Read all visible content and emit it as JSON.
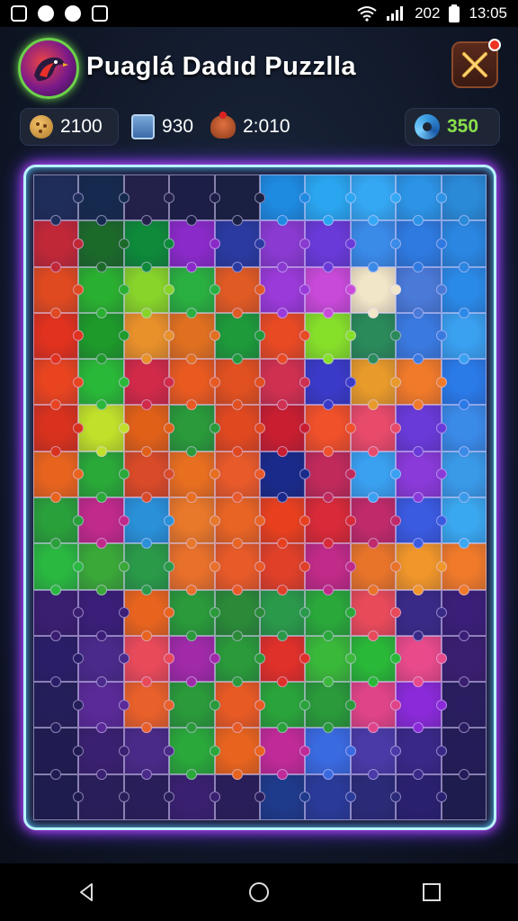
{
  "status_bar": {
    "left_icons": [
      "notification-icon",
      "clock-icon",
      "chat-icon",
      "image-icon"
    ],
    "right_text": "202",
    "time": "13:05"
  },
  "header": {
    "title": "Puaglá Dadıd Puzzlla",
    "avatar_icon": "bird-icon",
    "close_icon": "crossed-tools-icon"
  },
  "stats": {
    "coins": "2100",
    "boxes": "930",
    "time": "2:010",
    "score": "350"
  },
  "board": {
    "cols": 10,
    "rows": 14,
    "colors": [
      "#1f2d5a",
      "#152a4e",
      "#23204a",
      "#1c1e48",
      "#1a2042",
      "#1e8ae0",
      "#2aa6f0",
      "#35a8f4",
      "#2c94e6",
      "#2a8ad8",
      "#c02838",
      "#1c6a2a",
      "#0e8a3a",
      "#8a2ac8",
      "#2a3aa0",
      "#8a3ad0",
      "#6a3ad8",
      "#3a8ae8",
      "#2e7ae0",
      "#2a86e0",
      "#e04a20",
      "#2ab030",
      "#88d42a",
      "#2ab040",
      "#e05a24",
      "#9a3ad8",
      "#c84ad8",
      "#f2e6c8",
      "#4a7ad8",
      "#2a8ae8",
      "#e0321e",
      "#1e9a2a",
      "#e8902a",
      "#e07020",
      "#1e9a3a",
      "#e84a24",
      "#86e02a",
      "#2a8a5a",
      "#3a7ae0",
      "#3aa0f0",
      "#e84420",
      "#2ab838",
      "#d02a48",
      "#e85a20",
      "#e05020",
      "#d03050",
      "#3a3ac8",
      "#e89a2a",
      "#f07a2a",
      "#2a7ae8",
      "#d8321e",
      "#c0e02a",
      "#e06018",
      "#2a9a3a",
      "#e04820",
      "#c81e30",
      "#f0502a",
      "#e84a6a",
      "#6a3ad8",
      "#3a8ae8",
      "#e8641e",
      "#2aa838",
      "#d84a28",
      "#e86e20",
      "#e85a2a",
      "#1a2a8a",
      "#c02a5a",
      "#3aa0f0",
      "#8a3ad8",
      "#3a9ae8",
      "#2aa03a",
      "#c02a8a",
      "#2a90d8",
      "#e8782a",
      "#e86424",
      "#e8401e",
      "#d82a38",
      "#c02a6a",
      "#3a5ae0",
      "#3aa8f0",
      "#2ab840",
      "#3aa838",
      "#2a9a48",
      "#e8702a",
      "#e85a28",
      "#e04028",
      "#c02a88",
      "#e8742a",
      "#f0962a",
      "#f07a2a",
      "#3a1e70",
      "#3a1e78",
      "#e8641e",
      "#2a9a3a",
      "#2a8a38",
      "#2a9a4a",
      "#2aa83a",
      "#e84a5a",
      "#3a2a88",
      "#3a1e78",
      "#2a1e68",
      "#4a2a8a",
      "#e84a5a",
      "#a02aa8",
      "#2a9a3a",
      "#e0302a",
      "#3ab83a",
      "#2ab838",
      "#e84a8a",
      "#3a1e70",
      "#241e5a",
      "#5a2a98",
      "#e8602a",
      "#2a9a3a",
      "#e85a24",
      "#2aa43a",
      "#2a9a3a",
      "#e04488",
      "#8a2ad8",
      "#2a1e60",
      "#201c52",
      "#3a2070",
      "#4a2a88",
      "#2aa83a",
      "#e8641e",
      "#c02a98",
      "#3a6ae0",
      "#4a3aa8",
      "#3a2888",
      "#241c58",
      "#1e1c4e",
      "#2a1e5a",
      "#2a1e5a",
      "#3a2070",
      "#2a1e5a",
      "#1e3a8a",
      "#2a3a98",
      "#2a2a78",
      "#2a2070",
      "#1e1c4e"
    ]
  }
}
